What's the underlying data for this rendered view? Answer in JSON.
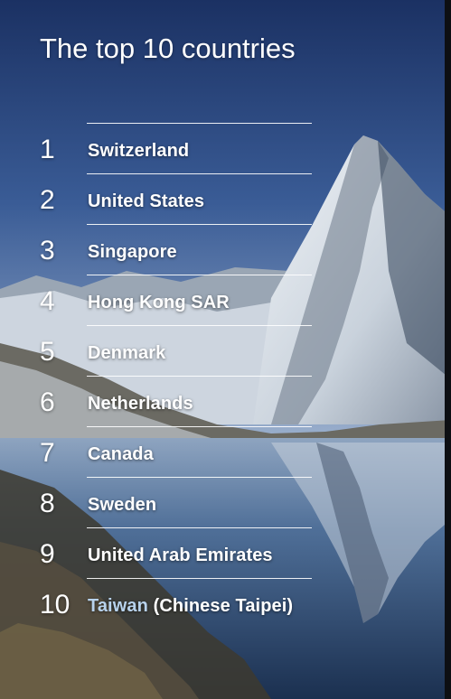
{
  "title": "The top 10 countries",
  "countries": [
    {
      "rank": "1",
      "name": "Switzerland"
    },
    {
      "rank": "2",
      "name": "United States"
    },
    {
      "rank": "3",
      "name": "Singapore"
    },
    {
      "rank": "4",
      "name": "Hong Kong SAR"
    },
    {
      "rank": "5",
      "name": "Denmark"
    },
    {
      "rank": "6",
      "name": "Netherlands"
    },
    {
      "rank": "7",
      "name": "Canada"
    },
    {
      "rank": "8",
      "name": "Sweden"
    },
    {
      "rank": "9",
      "name": "United Arab Emirates"
    },
    {
      "rank": "10",
      "name_link": "Taiwan",
      "name_rest": " (Chinese Taipei)"
    }
  ],
  "colors": {
    "text": "#ffffff",
    "link": "#b8d2ec",
    "sky": "#2a4a85",
    "snow": "#e3e8ee",
    "water": "#2c4c76"
  },
  "background_icon": "mountain-lake-photo"
}
